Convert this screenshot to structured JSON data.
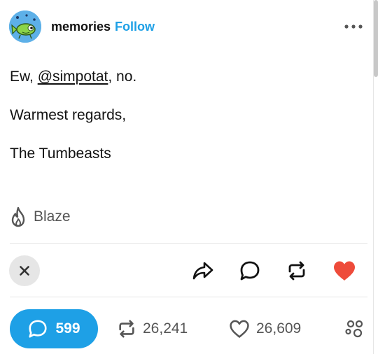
{
  "header": {
    "blog_name": "memories",
    "follow_label": "Follow",
    "more_icon": "more-horizontal-icon"
  },
  "post": {
    "greeting_prefix": "Ew, ",
    "mention": "@simpotat",
    "greeting_suffix": ", no.",
    "line2": "Warmest regards,",
    "line3": "The Tumbeasts"
  },
  "blaze": {
    "label": "Blaze",
    "icon": "flame-icon"
  },
  "actions": {
    "close_icon": "close-icon",
    "share_icon": "share-arrow-icon",
    "reply_icon": "comment-bubble-icon",
    "reblog_icon": "reblog-icon",
    "like_icon": "heart-icon",
    "like_color": "#ee4b3a"
  },
  "stats": {
    "replies": "599",
    "reblogs": "26,241",
    "likes": "26,609",
    "reactions_icon": "reactions-cluster-icon"
  },
  "colors": {
    "accent": "#1ea0e6",
    "text": "#121212",
    "muted": "#555555"
  }
}
